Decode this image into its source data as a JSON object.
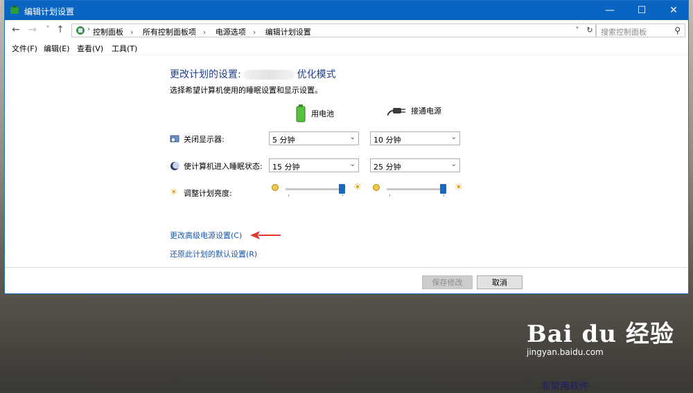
{
  "window": {
    "title": "编辑计划设置",
    "controls": {
      "minimize": "—",
      "maximize": "☐",
      "close": "✕"
    }
  },
  "nav": {
    "back": "←",
    "forward": "→",
    "recent": "˅",
    "up": "↑"
  },
  "address": {
    "crumbs": [
      "控制面板",
      "所有控制面板项",
      "电源选项",
      "编辑计划设置"
    ],
    "separator": "›",
    "dropdown": "˅",
    "refresh": "↻"
  },
  "search": {
    "placeholder": "搜索控制面板",
    "icon": "⚲"
  },
  "menu": [
    "文件(F)",
    "编辑(E)",
    "查看(V)",
    "工具(T)"
  ],
  "page": {
    "heading_prefix": "更改计划的设置:",
    "heading_suffix": "优化模式",
    "subtitle": "选择希望计算机使用的睡眠设置和显示设置。",
    "col_battery": "用电池",
    "col_plugged": "接通电源",
    "rows": {
      "display_label": "关闭显示器:",
      "display_battery": "5 分钟",
      "display_plugged": "10 分钟",
      "sleep_label": "使计算机进入睡眠状态:",
      "sleep_battery": "15 分钟",
      "sleep_plugged": "25 分钟",
      "brightness_label": "调整计划亮度:",
      "brightness_battery_level": 0.94,
      "brightness_plugged_level": 0.94
    },
    "link_advanced": "更改高级电源设置(C)",
    "link_restore": "还原此计划的默认设置(R)",
    "btn_save": "保存修改",
    "btn_cancel": "取消"
  },
  "watermark": {
    "brand": "Bai du 经验",
    "url": "jingyan.baidu.com",
    "bottom_text": "非常用软件"
  },
  "colors": {
    "titlebar": "#0a64c2",
    "heading": "#1e3f8a",
    "link": "#1a56a8",
    "slider_thumb": "#1669c2",
    "arrow": "#e03a2f"
  }
}
